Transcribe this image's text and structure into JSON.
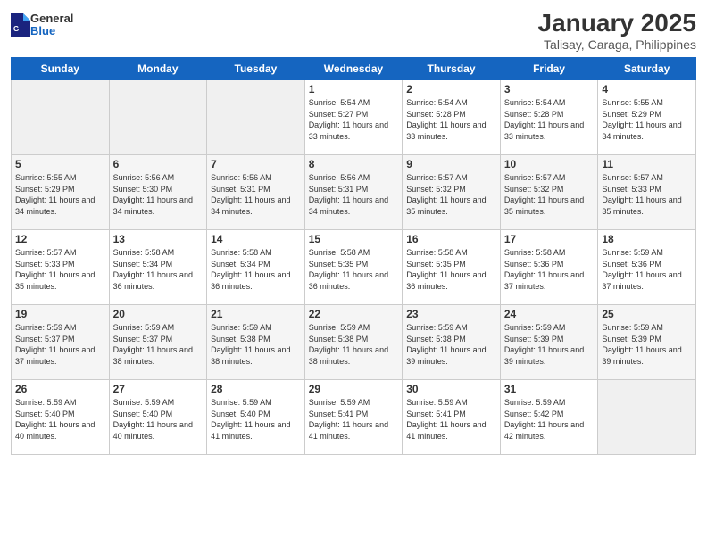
{
  "header": {
    "logo": {
      "general": "General",
      "blue": "Blue"
    },
    "title": "January 2025",
    "location": "Talisay, Caraga, Philippines"
  },
  "days_of_week": [
    "Sunday",
    "Monday",
    "Tuesday",
    "Wednesday",
    "Thursday",
    "Friday",
    "Saturday"
  ],
  "weeks": [
    [
      {
        "day": "",
        "empty": true
      },
      {
        "day": "",
        "empty": true
      },
      {
        "day": "",
        "empty": true
      },
      {
        "day": "1",
        "sunrise": "5:54 AM",
        "sunset": "5:27 PM",
        "daylight": "11 hours and 33 minutes."
      },
      {
        "day": "2",
        "sunrise": "5:54 AM",
        "sunset": "5:28 PM",
        "daylight": "11 hours and 33 minutes."
      },
      {
        "day": "3",
        "sunrise": "5:54 AM",
        "sunset": "5:28 PM",
        "daylight": "11 hours and 33 minutes."
      },
      {
        "day": "4",
        "sunrise": "5:55 AM",
        "sunset": "5:29 PM",
        "daylight": "11 hours and 34 minutes."
      }
    ],
    [
      {
        "day": "5",
        "sunrise": "5:55 AM",
        "sunset": "5:29 PM",
        "daylight": "11 hours and 34 minutes."
      },
      {
        "day": "6",
        "sunrise": "5:56 AM",
        "sunset": "5:30 PM",
        "daylight": "11 hours and 34 minutes."
      },
      {
        "day": "7",
        "sunrise": "5:56 AM",
        "sunset": "5:31 PM",
        "daylight": "11 hours and 34 minutes."
      },
      {
        "day": "8",
        "sunrise": "5:56 AM",
        "sunset": "5:31 PM",
        "daylight": "11 hours and 34 minutes."
      },
      {
        "day": "9",
        "sunrise": "5:57 AM",
        "sunset": "5:32 PM",
        "daylight": "11 hours and 35 minutes."
      },
      {
        "day": "10",
        "sunrise": "5:57 AM",
        "sunset": "5:32 PM",
        "daylight": "11 hours and 35 minutes."
      },
      {
        "day": "11",
        "sunrise": "5:57 AM",
        "sunset": "5:33 PM",
        "daylight": "11 hours and 35 minutes."
      }
    ],
    [
      {
        "day": "12",
        "sunrise": "5:57 AM",
        "sunset": "5:33 PM",
        "daylight": "11 hours and 35 minutes."
      },
      {
        "day": "13",
        "sunrise": "5:58 AM",
        "sunset": "5:34 PM",
        "daylight": "11 hours and 36 minutes."
      },
      {
        "day": "14",
        "sunrise": "5:58 AM",
        "sunset": "5:34 PM",
        "daylight": "11 hours and 36 minutes."
      },
      {
        "day": "15",
        "sunrise": "5:58 AM",
        "sunset": "5:35 PM",
        "daylight": "11 hours and 36 minutes."
      },
      {
        "day": "16",
        "sunrise": "5:58 AM",
        "sunset": "5:35 PM",
        "daylight": "11 hours and 36 minutes."
      },
      {
        "day": "17",
        "sunrise": "5:58 AM",
        "sunset": "5:36 PM",
        "daylight": "11 hours and 37 minutes."
      },
      {
        "day": "18",
        "sunrise": "5:59 AM",
        "sunset": "5:36 PM",
        "daylight": "11 hours and 37 minutes."
      }
    ],
    [
      {
        "day": "19",
        "sunrise": "5:59 AM",
        "sunset": "5:37 PM",
        "daylight": "11 hours and 37 minutes."
      },
      {
        "day": "20",
        "sunrise": "5:59 AM",
        "sunset": "5:37 PM",
        "daylight": "11 hours and 38 minutes."
      },
      {
        "day": "21",
        "sunrise": "5:59 AM",
        "sunset": "5:38 PM",
        "daylight": "11 hours and 38 minutes."
      },
      {
        "day": "22",
        "sunrise": "5:59 AM",
        "sunset": "5:38 PM",
        "daylight": "11 hours and 38 minutes."
      },
      {
        "day": "23",
        "sunrise": "5:59 AM",
        "sunset": "5:38 PM",
        "daylight": "11 hours and 39 minutes."
      },
      {
        "day": "24",
        "sunrise": "5:59 AM",
        "sunset": "5:39 PM",
        "daylight": "11 hours and 39 minutes."
      },
      {
        "day": "25",
        "sunrise": "5:59 AM",
        "sunset": "5:39 PM",
        "daylight": "11 hours and 39 minutes."
      }
    ],
    [
      {
        "day": "26",
        "sunrise": "5:59 AM",
        "sunset": "5:40 PM",
        "daylight": "11 hours and 40 minutes."
      },
      {
        "day": "27",
        "sunrise": "5:59 AM",
        "sunset": "5:40 PM",
        "daylight": "11 hours and 40 minutes."
      },
      {
        "day": "28",
        "sunrise": "5:59 AM",
        "sunset": "5:40 PM",
        "daylight": "11 hours and 41 minutes."
      },
      {
        "day": "29",
        "sunrise": "5:59 AM",
        "sunset": "5:41 PM",
        "daylight": "11 hours and 41 minutes."
      },
      {
        "day": "30",
        "sunrise": "5:59 AM",
        "sunset": "5:41 PM",
        "daylight": "11 hours and 41 minutes."
      },
      {
        "day": "31",
        "sunrise": "5:59 AM",
        "sunset": "5:42 PM",
        "daylight": "11 hours and 42 minutes."
      },
      {
        "day": "",
        "empty": true
      }
    ]
  ]
}
